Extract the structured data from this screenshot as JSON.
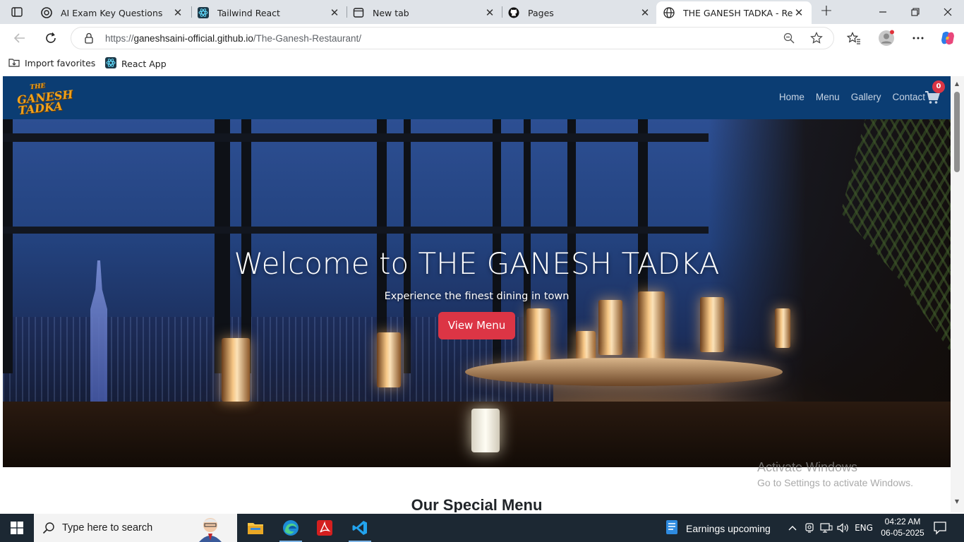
{
  "browser": {
    "tabs": [
      {
        "title": "AI Exam Key Questions",
        "icon": "chatgpt-icon"
      },
      {
        "title": "Tailwind React",
        "icon": "react-icon"
      },
      {
        "title": "New tab",
        "icon": "new-tab-icon"
      },
      {
        "title": "Pages",
        "icon": "github-icon"
      },
      {
        "title": "THE GANESH TADKA - Restau",
        "icon": "globe-icon",
        "active": true
      }
    ],
    "address": {
      "prefix": "https://",
      "host": "ganeshsaini-official.github.io",
      "path": "/The-Ganesh-Restaurant/"
    },
    "favorites": [
      {
        "label": "Import favorites",
        "icon": "import-favorites-icon"
      },
      {
        "label": "React App",
        "icon": "react-icon"
      }
    ]
  },
  "site": {
    "logo": {
      "line1": "THE",
      "line2": "GANESH",
      "line3": "TADKA"
    },
    "nav": [
      "Home",
      "Menu",
      "Gallery",
      "Contact"
    ],
    "cart_count": "0",
    "hero": {
      "title": "Welcome to THE GANESH TADKA",
      "subtitle": "Experience the finest dining in town",
      "button": "View Menu"
    },
    "section_title": "Our Special Menu"
  },
  "watermark": {
    "line1": "Activate Windows",
    "line2": "Go to Settings to activate Windows."
  },
  "taskbar": {
    "search_placeholder": "Type here to search",
    "news": "Earnings upcoming",
    "language": "ENG",
    "time": "04:22 AM",
    "date": "06-05-2025"
  },
  "colors": {
    "site_nav": "#0b3d73",
    "accent_red": "#dc3545",
    "logo_gold": "#f0a21c"
  }
}
